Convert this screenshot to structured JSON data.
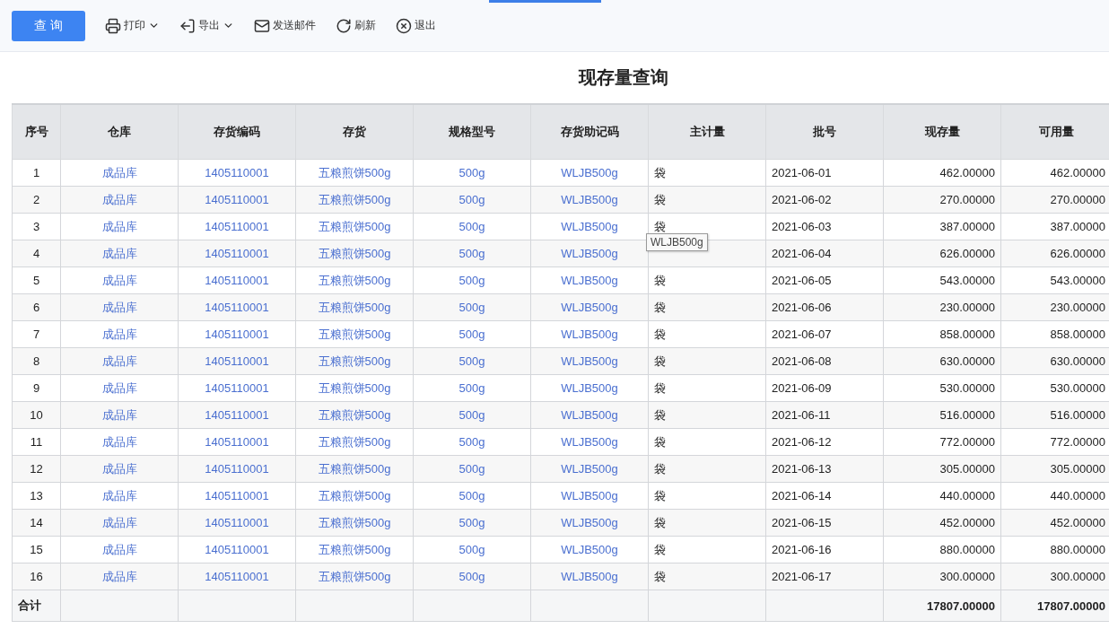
{
  "toolbar": {
    "primary_button": "查 询",
    "items": [
      {
        "label": "打印",
        "has_menu": true
      },
      {
        "label": "导出",
        "has_menu": true
      },
      {
        "label": "发送邮件",
        "has_menu": false
      },
      {
        "label": "刷新",
        "has_menu": false
      },
      {
        "label": "退出",
        "has_menu": false
      }
    ]
  },
  "title": "现存量查询",
  "table": {
    "columns": [
      {
        "label": "序号",
        "kind": "index"
      },
      {
        "label": "仓库",
        "kind": "link"
      },
      {
        "label": "存货编码",
        "kind": "link"
      },
      {
        "label": "存货",
        "kind": "link"
      },
      {
        "label": "规格型号",
        "kind": "link"
      },
      {
        "label": "存货助记码",
        "kind": "link"
      },
      {
        "label": "主计量",
        "kind": "text"
      },
      {
        "label": "批号",
        "kind": "text"
      },
      {
        "label": "现存量",
        "kind": "number"
      },
      {
        "label": "可用量",
        "kind": "number"
      }
    ],
    "rows": [
      [
        "1",
        "成品库",
        "1405110001",
        "五粮煎饼500g",
        "500g",
        "WLJB500g",
        "袋",
        "2021-06-01",
        "462.00000",
        "462.00000"
      ],
      [
        "2",
        "成品库",
        "1405110001",
        "五粮煎饼500g",
        "500g",
        "WLJB500g",
        "袋",
        "2021-06-02",
        "270.00000",
        "270.00000"
      ],
      [
        "3",
        "成品库",
        "1405110001",
        "五粮煎饼500g",
        "500g",
        "WLJB500g",
        "袋",
        "2021-06-03",
        "387.00000",
        "387.00000"
      ],
      [
        "4",
        "成品库",
        "1405110001",
        "五粮煎饼500g",
        "500g",
        "WLJB500g",
        null,
        "2021-06-04",
        "626.00000",
        "626.00000"
      ],
      [
        "5",
        "成品库",
        "1405110001",
        "五粮煎饼500g",
        "500g",
        "WLJB500g",
        "袋",
        "2021-06-05",
        "543.00000",
        "543.00000"
      ],
      [
        "6",
        "成品库",
        "1405110001",
        "五粮煎饼500g",
        "500g",
        "WLJB500g",
        "袋",
        "2021-06-06",
        "230.00000",
        "230.00000"
      ],
      [
        "7",
        "成品库",
        "1405110001",
        "五粮煎饼500g",
        "500g",
        "WLJB500g",
        "袋",
        "2021-06-07",
        "858.00000",
        "858.00000"
      ],
      [
        "8",
        "成品库",
        "1405110001",
        "五粮煎饼500g",
        "500g",
        "WLJB500g",
        "袋",
        "2021-06-08",
        "630.00000",
        "630.00000"
      ],
      [
        "9",
        "成品库",
        "1405110001",
        "五粮煎饼500g",
        "500g",
        "WLJB500g",
        "袋",
        "2021-06-09",
        "530.00000",
        "530.00000"
      ],
      [
        "10",
        "成品库",
        "1405110001",
        "五粮煎饼500g",
        "500g",
        "WLJB500g",
        "袋",
        "2021-06-11",
        "516.00000",
        "516.00000"
      ],
      [
        "11",
        "成品库",
        "1405110001",
        "五粮煎饼500g",
        "500g",
        "WLJB500g",
        "袋",
        "2021-06-12",
        "772.00000",
        "772.00000"
      ],
      [
        "12",
        "成品库",
        "1405110001",
        "五粮煎饼500g",
        "500g",
        "WLJB500g",
        "袋",
        "2021-06-13",
        "305.00000",
        "305.00000"
      ],
      [
        "13",
        "成品库",
        "1405110001",
        "五粮煎饼500g",
        "500g",
        "WLJB500g",
        "袋",
        "2021-06-14",
        "440.00000",
        "440.00000"
      ],
      [
        "14",
        "成品库",
        "1405110001",
        "五粮煎饼500g",
        "500g",
        "WLJB500g",
        "袋",
        "2021-06-15",
        "452.00000",
        "452.00000"
      ],
      [
        "15",
        "成品库",
        "1405110001",
        "五粮煎饼500g",
        "500g",
        "WLJB500g",
        "袋",
        "2021-06-16",
        "880.00000",
        "880.00000"
      ],
      [
        "16",
        "成品库",
        "1405110001",
        "五粮煎饼500g",
        "500g",
        "WLJB500g",
        "袋",
        "2021-06-17",
        "300.00000",
        "300.00000"
      ]
    ],
    "total": {
      "label": "合计",
      "on_hand": "17807.00000",
      "available": "17807.00000"
    }
  },
  "tooltip": {
    "text": "WLJB500g"
  }
}
